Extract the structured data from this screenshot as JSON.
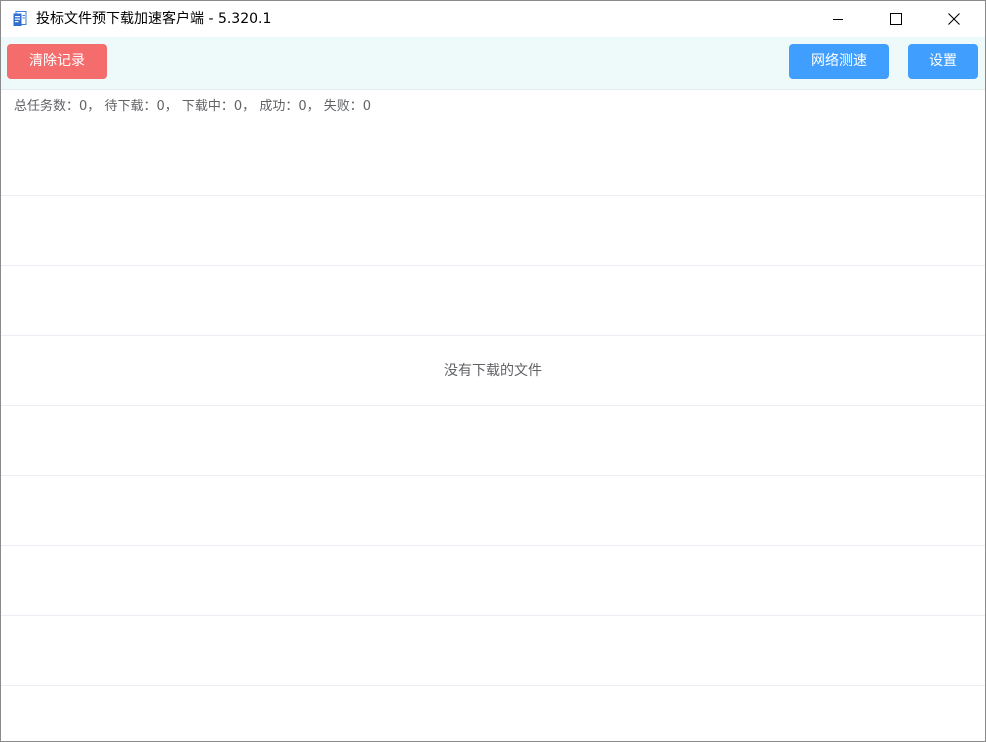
{
  "window": {
    "title": "投标文件预下载加速客户端 - 5.320.1",
    "icon": "app-document-icon",
    "controls": {
      "minimize": "minimize-icon",
      "maximize": "maximize-icon",
      "close": "close-icon"
    }
  },
  "toolbar": {
    "clear_label": "清除记录",
    "speedtest_label": "网络测速",
    "settings_label": "设置"
  },
  "stats": {
    "total_label": "总任务数：",
    "total": "0",
    "pending_label": "待下载：",
    "pending": "0",
    "downloading_label": "下载中：",
    "downloading": "0",
    "success_label": "成功：",
    "success": "0",
    "failed_label": "失败：",
    "failed": "0",
    "separator": "， "
  },
  "list": {
    "empty_text": "没有下载的文件"
  },
  "colors": {
    "danger": "#f56c6c",
    "primary": "#409eff",
    "toolbar_bg": "#eef9fa",
    "text_secondary": "#606266"
  }
}
